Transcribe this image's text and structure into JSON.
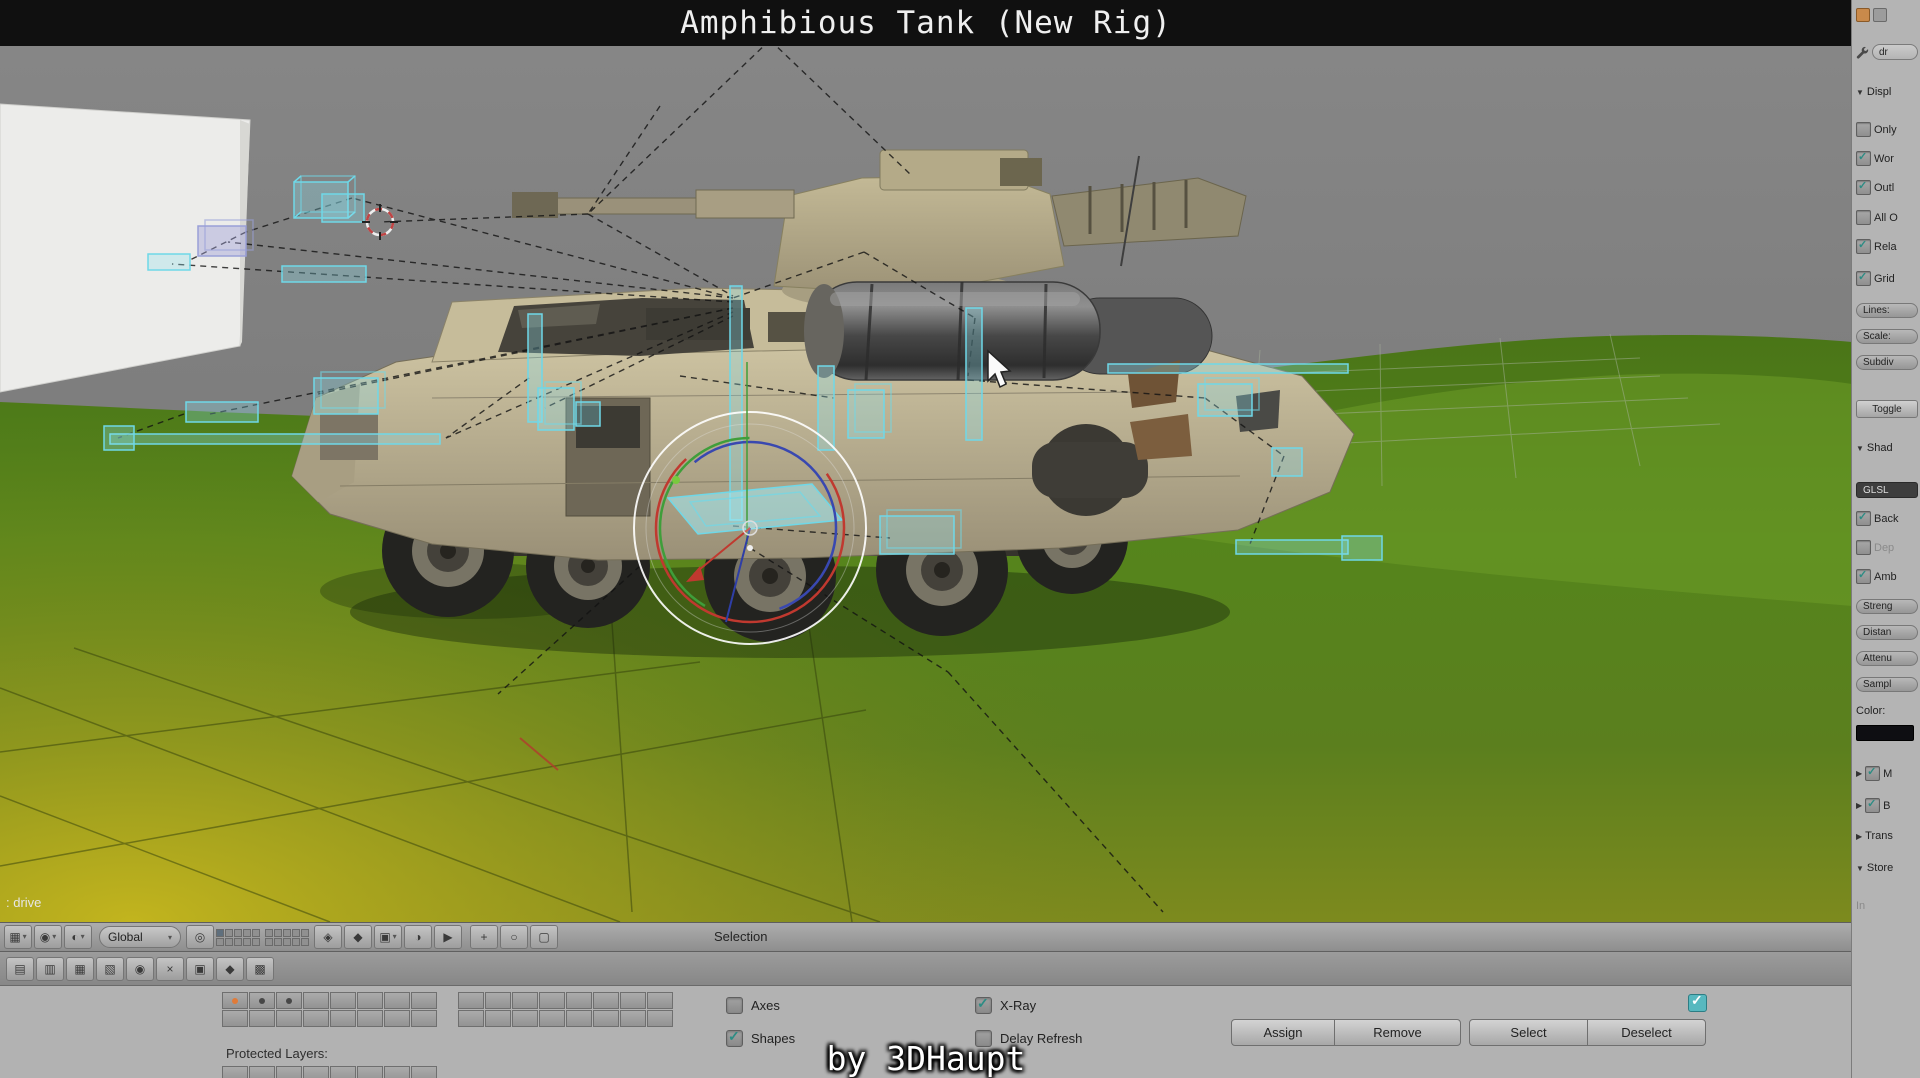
{
  "window": {
    "title": "Amphibious Tank (New Rig)",
    "caption": "by 3DHaupt"
  },
  "ui": {
    "dropdown_arrow": "▾",
    "section_expanded": "▼",
    "section_collapsed": "▶",
    "check_glyph": "✓"
  },
  "viewport": {
    "info_text": ": drive",
    "header": {
      "orientation_label": "Global",
      "status_label": "Selection",
      "icons": [
        {
          "name": "editor-type",
          "glyph": "▦"
        },
        {
          "name": "mode",
          "glyph": "◉"
        },
        {
          "name": "viewport-shading",
          "glyph": "◐"
        },
        {
          "name": "pivot-point",
          "glyph": "◎"
        },
        {
          "name": "lock",
          "glyph": "◈"
        },
        {
          "name": "snap-magnet",
          "glyph": "◆"
        },
        {
          "name": "snap-element",
          "glyph": "▣"
        },
        {
          "name": "render-opengl",
          "glyph": "◑"
        },
        {
          "name": "render-anim",
          "glyph": "▶"
        },
        {
          "name": "manipulator-translate",
          "glyph": "+"
        },
        {
          "name": "manipulator-rotate",
          "glyph": "○"
        },
        {
          "name": "manipulator-scale",
          "glyph": "▢"
        }
      ]
    },
    "toolbar2_icons": [
      {
        "glyph": "▤"
      },
      {
        "glyph": "▥"
      },
      {
        "glyph": "▦"
      },
      {
        "glyph": "▧"
      },
      {
        "glyph": "◉"
      },
      {
        "glyph": "×"
      },
      {
        "glyph": "▣"
      },
      {
        "glyph": "◆"
      },
      {
        "glyph": "▩"
      }
    ]
  },
  "right_panel": {
    "name_field": {
      "value": "dr"
    },
    "display_section": {
      "header": "Displ",
      "checkboxes": [
        {
          "label": "Only",
          "checked": false
        },
        {
          "label": "Wor",
          "checked": true
        },
        {
          "label": "Outl",
          "checked": true
        },
        {
          "label": "All O",
          "checked": false
        },
        {
          "label": "Rela",
          "checked": true
        },
        {
          "label": "Grid",
          "checked": true
        }
      ],
      "sliders": [
        "Lines:",
        "Scale:",
        "Subdiv"
      ],
      "button": "Toggle"
    },
    "shading_section": {
      "header": "Shad",
      "menu_value": "GLSL",
      "checkboxes": [
        {
          "label": "Back",
          "checked": true
        },
        {
          "label": "Dep",
          "checked": false
        },
        {
          "label": "Amb",
          "checked": true
        }
      ],
      "sliders": [
        "Streng",
        "Distan",
        "Attenu",
        "Sampl"
      ],
      "color_label": "Color:"
    },
    "collapsed_rows": [
      {
        "arrow": "▶",
        "label": "M",
        "checked": true
      },
      {
        "arrow": "▶",
        "label": "B",
        "checked": true
      },
      {
        "arrow": "▶",
        "label": "Trans",
        "checked": false
      },
      {
        "arrow": "▼",
        "label": "Store",
        "checked": false
      }
    ],
    "partial_row": "In"
  },
  "tool_shelf": {
    "protected_layers_label": "Protected Layers:",
    "checkboxes": [
      {
        "label": "Axes",
        "checked": false
      },
      {
        "label": "Shapes",
        "checked": true
      },
      {
        "label": "X-Ray",
        "checked": true
      },
      {
        "label": "Delay Refresh",
        "checked": false
      }
    ],
    "buttons": [
      "Assign",
      "Remove",
      "Select",
      "Deselect"
    ],
    "side_toggle_checked": true
  },
  "colors": {
    "rig_accent": "#6fd8e8",
    "grass_green": "#55851c",
    "ground_yellow": "#b7a81e",
    "sky_gray": "#7d7d7d",
    "active_layer_dot": "#e07b39",
    "check_teal": "#2d8c84",
    "titlebar_bg": "#101010"
  }
}
